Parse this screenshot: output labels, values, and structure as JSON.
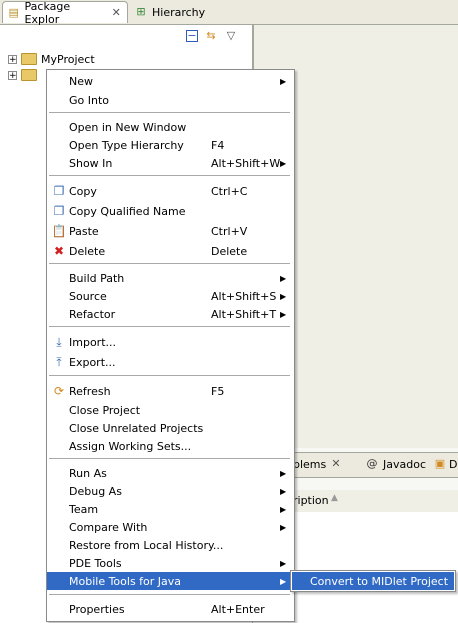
{
  "tabs": {
    "package_explorer": "Package Explor",
    "hierarchy": "Hierarchy"
  },
  "tree": {
    "project": "MyProject"
  },
  "bottom_tabs": {
    "problems": "blems",
    "javadoc": "Javadoc",
    "declaration": "D"
  },
  "bottom_header": {
    "description": "ription"
  },
  "menu": {
    "new": "New",
    "go_into": "Go Into",
    "open_new_window": "Open in New Window",
    "open_type_hierarchy": "Open Type Hierarchy",
    "open_type_hierarchy_sc": "F4",
    "show_in": "Show In",
    "show_in_sc": "Alt+Shift+W",
    "copy": "Copy",
    "copy_sc": "Ctrl+C",
    "copy_qualified": "Copy Qualified Name",
    "paste": "Paste",
    "paste_sc": "Ctrl+V",
    "delete": "Delete",
    "delete_sc": "Delete",
    "build_path": "Build Path",
    "source": "Source",
    "source_sc": "Alt+Shift+S",
    "refactor": "Refactor",
    "refactor_sc": "Alt+Shift+T",
    "import": "Import...",
    "export": "Export...",
    "refresh": "Refresh",
    "refresh_sc": "F5",
    "close_project": "Close Project",
    "close_unrelated": "Close Unrelated Projects",
    "assign_working_sets": "Assign Working Sets...",
    "run_as": "Run As",
    "debug_as": "Debug As",
    "team": "Team",
    "compare_with": "Compare With",
    "restore_local_history": "Restore from Local History...",
    "pde_tools": "PDE Tools",
    "mobile_tools": "Mobile Tools for Java",
    "properties": "Properties",
    "properties_sc": "Alt+Enter"
  },
  "submenu": {
    "convert_midlet": "Convert to MIDlet Project"
  },
  "colors": {
    "highlight": "#316ac5"
  }
}
